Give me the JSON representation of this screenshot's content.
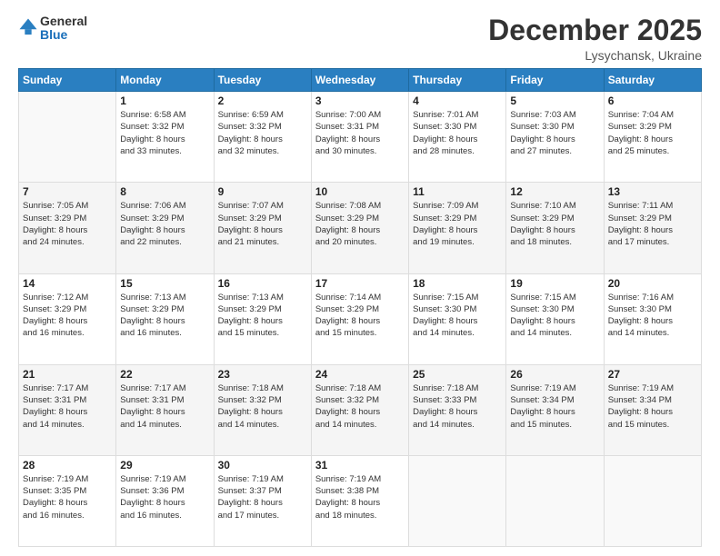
{
  "logo": {
    "general": "General",
    "blue": "Blue"
  },
  "title": "December 2025",
  "location": "Lysychansk, Ukraine",
  "days_header": [
    "Sunday",
    "Monday",
    "Tuesday",
    "Wednesday",
    "Thursday",
    "Friday",
    "Saturday"
  ],
  "weeks": [
    [
      {
        "day": "",
        "info": ""
      },
      {
        "day": "1",
        "info": "Sunrise: 6:58 AM\nSunset: 3:32 PM\nDaylight: 8 hours\nand 33 minutes."
      },
      {
        "day": "2",
        "info": "Sunrise: 6:59 AM\nSunset: 3:32 PM\nDaylight: 8 hours\nand 32 minutes."
      },
      {
        "day": "3",
        "info": "Sunrise: 7:00 AM\nSunset: 3:31 PM\nDaylight: 8 hours\nand 30 minutes."
      },
      {
        "day": "4",
        "info": "Sunrise: 7:01 AM\nSunset: 3:30 PM\nDaylight: 8 hours\nand 28 minutes."
      },
      {
        "day": "5",
        "info": "Sunrise: 7:03 AM\nSunset: 3:30 PM\nDaylight: 8 hours\nand 27 minutes."
      },
      {
        "day": "6",
        "info": "Sunrise: 7:04 AM\nSunset: 3:29 PM\nDaylight: 8 hours\nand 25 minutes."
      }
    ],
    [
      {
        "day": "7",
        "info": "Sunrise: 7:05 AM\nSunset: 3:29 PM\nDaylight: 8 hours\nand 24 minutes."
      },
      {
        "day": "8",
        "info": "Sunrise: 7:06 AM\nSunset: 3:29 PM\nDaylight: 8 hours\nand 22 minutes."
      },
      {
        "day": "9",
        "info": "Sunrise: 7:07 AM\nSunset: 3:29 PM\nDaylight: 8 hours\nand 21 minutes."
      },
      {
        "day": "10",
        "info": "Sunrise: 7:08 AM\nSunset: 3:29 PM\nDaylight: 8 hours\nand 20 minutes."
      },
      {
        "day": "11",
        "info": "Sunrise: 7:09 AM\nSunset: 3:29 PM\nDaylight: 8 hours\nand 19 minutes."
      },
      {
        "day": "12",
        "info": "Sunrise: 7:10 AM\nSunset: 3:29 PM\nDaylight: 8 hours\nand 18 minutes."
      },
      {
        "day": "13",
        "info": "Sunrise: 7:11 AM\nSunset: 3:29 PM\nDaylight: 8 hours\nand 17 minutes."
      }
    ],
    [
      {
        "day": "14",
        "info": "Sunrise: 7:12 AM\nSunset: 3:29 PM\nDaylight: 8 hours\nand 16 minutes."
      },
      {
        "day": "15",
        "info": "Sunrise: 7:13 AM\nSunset: 3:29 PM\nDaylight: 8 hours\nand 16 minutes."
      },
      {
        "day": "16",
        "info": "Sunrise: 7:13 AM\nSunset: 3:29 PM\nDaylight: 8 hours\nand 15 minutes."
      },
      {
        "day": "17",
        "info": "Sunrise: 7:14 AM\nSunset: 3:29 PM\nDaylight: 8 hours\nand 15 minutes."
      },
      {
        "day": "18",
        "info": "Sunrise: 7:15 AM\nSunset: 3:30 PM\nDaylight: 8 hours\nand 14 minutes."
      },
      {
        "day": "19",
        "info": "Sunrise: 7:15 AM\nSunset: 3:30 PM\nDaylight: 8 hours\nand 14 minutes."
      },
      {
        "day": "20",
        "info": "Sunrise: 7:16 AM\nSunset: 3:30 PM\nDaylight: 8 hours\nand 14 minutes."
      }
    ],
    [
      {
        "day": "21",
        "info": "Sunrise: 7:17 AM\nSunset: 3:31 PM\nDaylight: 8 hours\nand 14 minutes."
      },
      {
        "day": "22",
        "info": "Sunrise: 7:17 AM\nSunset: 3:31 PM\nDaylight: 8 hours\nand 14 minutes."
      },
      {
        "day": "23",
        "info": "Sunrise: 7:18 AM\nSunset: 3:32 PM\nDaylight: 8 hours\nand 14 minutes."
      },
      {
        "day": "24",
        "info": "Sunrise: 7:18 AM\nSunset: 3:32 PM\nDaylight: 8 hours\nand 14 minutes."
      },
      {
        "day": "25",
        "info": "Sunrise: 7:18 AM\nSunset: 3:33 PM\nDaylight: 8 hours\nand 14 minutes."
      },
      {
        "day": "26",
        "info": "Sunrise: 7:19 AM\nSunset: 3:34 PM\nDaylight: 8 hours\nand 15 minutes."
      },
      {
        "day": "27",
        "info": "Sunrise: 7:19 AM\nSunset: 3:34 PM\nDaylight: 8 hours\nand 15 minutes."
      }
    ],
    [
      {
        "day": "28",
        "info": "Sunrise: 7:19 AM\nSunset: 3:35 PM\nDaylight: 8 hours\nand 16 minutes."
      },
      {
        "day": "29",
        "info": "Sunrise: 7:19 AM\nSunset: 3:36 PM\nDaylight: 8 hours\nand 16 minutes."
      },
      {
        "day": "30",
        "info": "Sunrise: 7:19 AM\nSunset: 3:37 PM\nDaylight: 8 hours\nand 17 minutes."
      },
      {
        "day": "31",
        "info": "Sunrise: 7:19 AM\nSunset: 3:38 PM\nDaylight: 8 hours\nand 18 minutes."
      },
      {
        "day": "",
        "info": ""
      },
      {
        "day": "",
        "info": ""
      },
      {
        "day": "",
        "info": ""
      }
    ]
  ]
}
